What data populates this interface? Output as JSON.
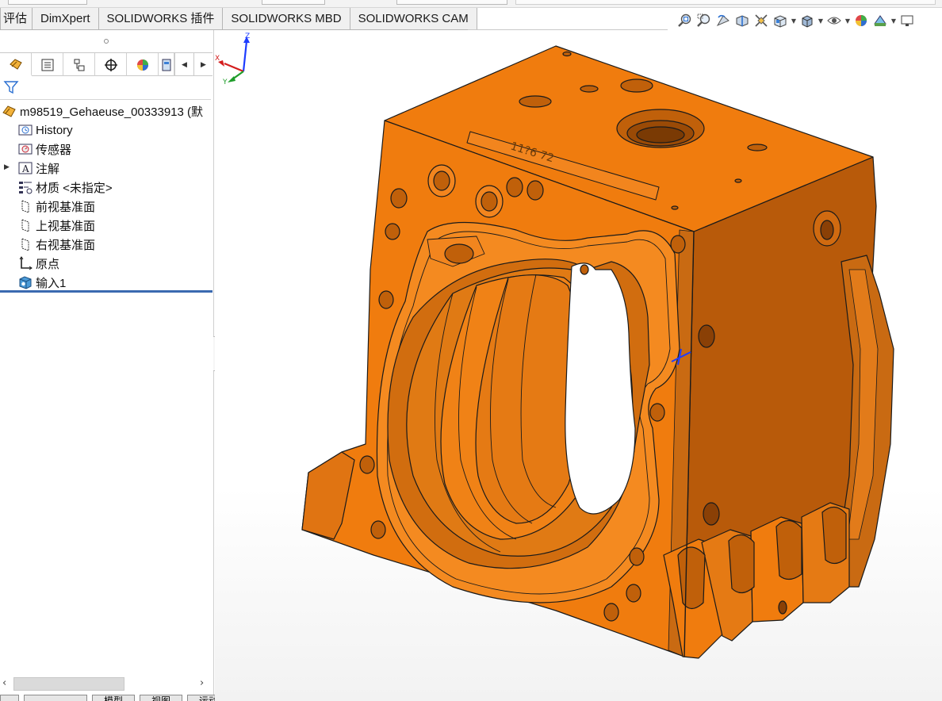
{
  "command_tabs": [
    {
      "label": "评估"
    },
    {
      "label": "DimXpert"
    },
    {
      "label": "SOLIDWORKS 插件"
    },
    {
      "label": "SOLIDWORKS MBD"
    },
    {
      "label": "SOLIDWORKS CAM"
    }
  ],
  "heads_up_toolbar": [
    {
      "icon": "zoom-to-fit-icon"
    },
    {
      "icon": "zoom-to-area-icon"
    },
    {
      "icon": "previous-view-icon"
    },
    {
      "icon": "section-view-icon"
    },
    {
      "icon": "dynamic-annotation-icon"
    },
    {
      "icon": "view-orientation-icon"
    },
    {
      "icon": "display-style-icon"
    },
    {
      "icon": "hide-show-items-icon"
    },
    {
      "icon": "edit-appearance-icon"
    },
    {
      "icon": "apply-scene-icon"
    },
    {
      "icon": "view-settings-icon"
    }
  ],
  "panel_tabs": [
    {
      "icon": "feature-manager-icon"
    },
    {
      "icon": "property-manager-icon"
    },
    {
      "icon": "configuration-manager-icon"
    },
    {
      "icon": "dimxpert-manager-icon"
    },
    {
      "icon": "display-manager-icon"
    },
    {
      "icon": "cam-manager-icon"
    }
  ],
  "feature_tree": {
    "root": "m98519_Gehaeuse_00333913  (默",
    "items": [
      {
        "label": "History",
        "icon": "history-icon"
      },
      {
        "label": "传感器",
        "icon": "sensor-icon"
      },
      {
        "label": "注解",
        "icon": "annotations-icon",
        "expandable": true
      },
      {
        "label": "材质 <未指定>",
        "icon": "material-icon"
      },
      {
        "label": "前视基准面",
        "icon": "plane-icon"
      },
      {
        "label": "上视基准面",
        "icon": "plane-icon"
      },
      {
        "label": "右视基准面",
        "icon": "plane-icon"
      },
      {
        "label": "原点",
        "icon": "origin-icon"
      },
      {
        "label": "输入1",
        "icon": "imported-body-icon"
      }
    ]
  },
  "bottom_tabs": [
    {
      "label": "模型"
    },
    {
      "label": "视图"
    },
    {
      "label": "运动算例"
    }
  ],
  "part_engraving": "11?6 72",
  "triad_axes": {
    "x": "X",
    "y": "Y",
    "z": "Z"
  },
  "colors": {
    "part_orange": "#f07c0e",
    "part_shadow": "#b85a0a",
    "part_highlight": "#f59b40",
    "edge": "#1a1a1a"
  }
}
